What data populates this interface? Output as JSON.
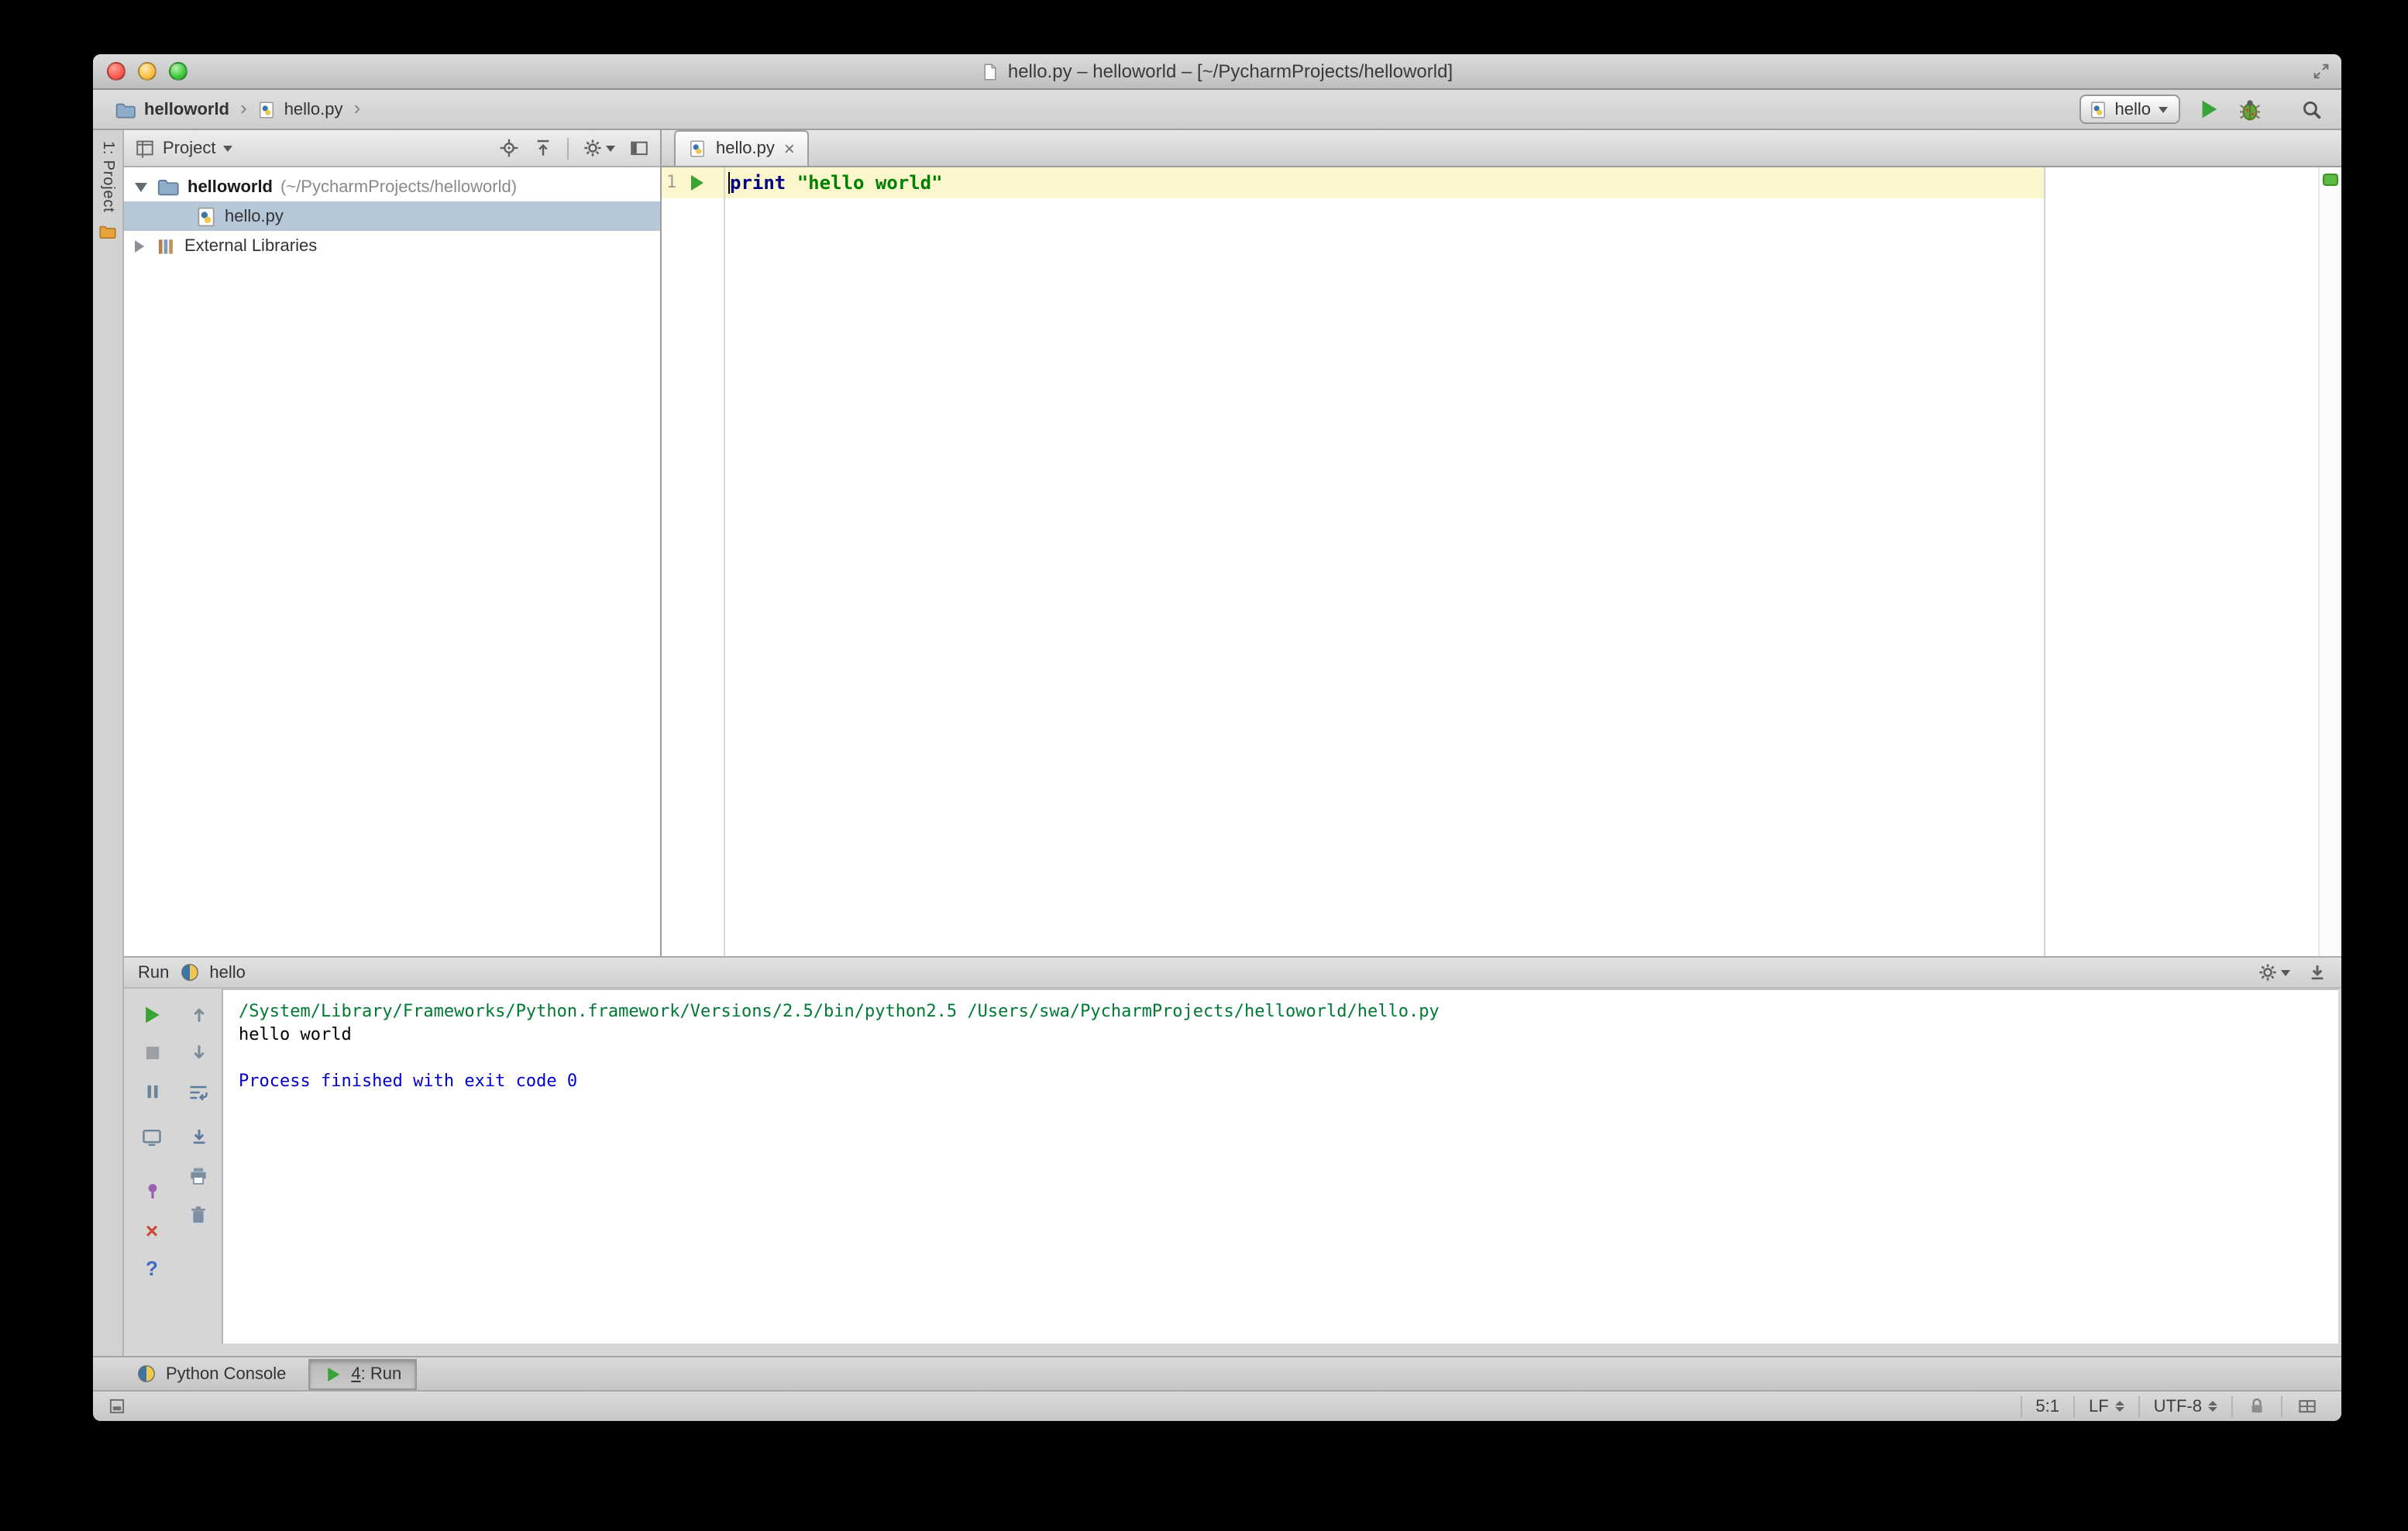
{
  "titlebar": {
    "title": "hello.py – helloworld – [~/PycharmProjects/helloworld]"
  },
  "navbar": {
    "breadcrumbs": [
      "helloworld",
      "hello.py"
    ],
    "run_config": "hello"
  },
  "stripe": {
    "project_label": "1: Project"
  },
  "project": {
    "header_label": "Project",
    "tree": [
      {
        "name": "helloworld",
        "detail": "(~/PycharmProjects/helloworld)"
      },
      {
        "name": "hello.py",
        "detail": ""
      },
      {
        "name": "External Libraries",
        "detail": ""
      }
    ]
  },
  "editor": {
    "tab_label": "hello.py",
    "line_number": "1",
    "code_keyword": "print",
    "code_string": "\"hello world\""
  },
  "run": {
    "panel_title": "Run",
    "config_name": "hello",
    "console": [
      {
        "text": "/System/Library/Frameworks/Python.framework/Versions/2.5/bin/python2.5 /Users/swa/PycharmProjects/helloworld/hello.py",
        "kind": "command"
      },
      {
        "text": "hello world",
        "kind": "stdout"
      },
      {
        "text": "",
        "kind": "stdout"
      },
      {
        "text": "Process finished with exit code 0",
        "kind": "system"
      }
    ]
  },
  "bottom_bar": {
    "python_console_label": "Python Console",
    "run_tab_mnemonic": "4",
    "run_tab_rest": ": Run"
  },
  "statusbar": {
    "caret_position": "5:1",
    "line_separator": "LF",
    "encoding": "UTF-8"
  },
  "colors": {
    "keyword": "#000080",
    "string": "#008000",
    "console_command": "#007a33",
    "console_system": "#0000cc",
    "caret_row": "#fcf6cc",
    "tree_selection": "#b6c8d8",
    "run_green": "#3aa338",
    "inspection_ok": "#5fb944"
  },
  "icons": {
    "close-window": "red-circle",
    "minimize-window": "yellow-circle",
    "zoom-window": "green-circle",
    "document-proxy": "page",
    "fullscreen": "diagonal-arrows",
    "folder": "folder-shape",
    "python-file": "page-with-blue-yellow-dots",
    "breadcrumb-chevron": "›",
    "run": "green-triangle",
    "debug": "bug",
    "search": "magnifier",
    "project-view": "split-window",
    "scroll-from-source": "crosshair",
    "collapse-all": "arrow-up-to-line",
    "settings": "gear",
    "hide-panel": "panel-filled-edge",
    "external-libraries": "book-stack",
    "rerun": "green-triangle",
    "stop": "gray-square",
    "pause-output": "pause-bars",
    "show-console": "monitor",
    "attach": "purple-pin",
    "close": "red-x",
    "help": "question-mark",
    "prev-occurrence": "up-arrow",
    "next-occurrence": "down-arrow",
    "soft-wrap": "wrap-lines",
    "scroll-to-end": "arrow-down-to-line",
    "print": "printer",
    "clear-all": "trash-can",
    "lock": "padlock",
    "screens": "monitor-grid",
    "toggle-toolwindows": "square"
  }
}
